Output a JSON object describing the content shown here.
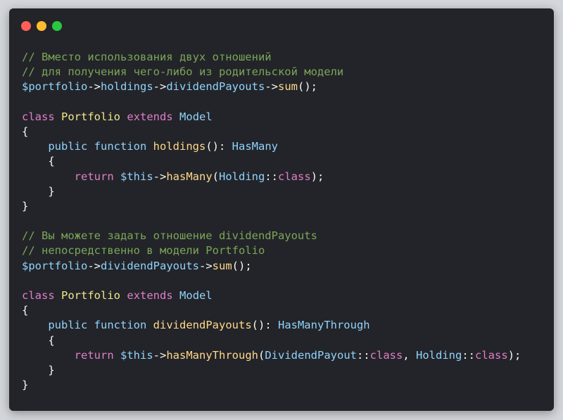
{
  "window": {
    "buttons": [
      {
        "name": "close",
        "color": "#ff5f57"
      },
      {
        "name": "minimize",
        "color": "#febc2e"
      },
      {
        "name": "maximize",
        "color": "#28c840"
      }
    ]
  },
  "colors": {
    "com": "#7ba659",
    "var": "#8fd3fc",
    "op": "#f8f8f2",
    "fn": "#ffd98a",
    "kw": "#e07ec8",
    "cls": "#f1e88a",
    "typ": "#8fd3fc",
    "p": "#f8f8f2"
  },
  "code_lines": [
    [
      [
        "com",
        "// Вместо использования двух отношений"
      ]
    ],
    [
      [
        "com",
        "// для получения чего-либо из родительской модели"
      ]
    ],
    [
      [
        "var",
        "$portfolio"
      ],
      [
        "op",
        "->"
      ],
      [
        "var",
        "holdings"
      ],
      [
        "op",
        "->"
      ],
      [
        "var",
        "dividendPayouts"
      ],
      [
        "op",
        "->"
      ],
      [
        "fn",
        "sum"
      ],
      [
        "p",
        "();"
      ]
    ],
    [],
    [
      [
        "kw",
        "class"
      ],
      [
        "p",
        " "
      ],
      [
        "cls",
        "Portfolio"
      ],
      [
        "p",
        " "
      ],
      [
        "kw",
        "extends"
      ],
      [
        "p",
        " "
      ],
      [
        "typ",
        "Model"
      ]
    ],
    [
      [
        "p",
        "{"
      ]
    ],
    [
      [
        "p",
        "    "
      ],
      [
        "var",
        "public"
      ],
      [
        "p",
        " "
      ],
      [
        "var",
        "function"
      ],
      [
        "p",
        " "
      ],
      [
        "fn",
        "holdings"
      ],
      [
        "p",
        "(): "
      ],
      [
        "typ",
        "HasMany"
      ]
    ],
    [
      [
        "p",
        "    {"
      ]
    ],
    [
      [
        "p",
        "        "
      ],
      [
        "kw",
        "return"
      ],
      [
        "p",
        " "
      ],
      [
        "var",
        "$this"
      ],
      [
        "op",
        "->"
      ],
      [
        "fn",
        "hasMany"
      ],
      [
        "p",
        "("
      ],
      [
        "typ",
        "Holding"
      ],
      [
        "op",
        "::"
      ],
      [
        "kw",
        "class"
      ],
      [
        "p",
        ");"
      ]
    ],
    [
      [
        "p",
        "    }"
      ]
    ],
    [
      [
        "p",
        "}"
      ]
    ],
    [],
    [
      [
        "com",
        "// Вы можете задать отношение dividendPayouts"
      ]
    ],
    [
      [
        "com",
        "// непосредственно в модели Portfolio"
      ]
    ],
    [
      [
        "var",
        "$portfolio"
      ],
      [
        "op",
        "->"
      ],
      [
        "var",
        "dividendPayouts"
      ],
      [
        "op",
        "->"
      ],
      [
        "fn",
        "sum"
      ],
      [
        "p",
        "();"
      ]
    ],
    [],
    [
      [
        "kw",
        "class"
      ],
      [
        "p",
        " "
      ],
      [
        "cls",
        "Portfolio"
      ],
      [
        "p",
        " "
      ],
      [
        "kw",
        "extends"
      ],
      [
        "p",
        " "
      ],
      [
        "typ",
        "Model"
      ]
    ],
    [
      [
        "p",
        "{"
      ]
    ],
    [
      [
        "p",
        "    "
      ],
      [
        "var",
        "public"
      ],
      [
        "p",
        " "
      ],
      [
        "var",
        "function"
      ],
      [
        "p",
        " "
      ],
      [
        "fn",
        "dividendPayouts"
      ],
      [
        "p",
        "(): "
      ],
      [
        "typ",
        "HasManyThrough"
      ]
    ],
    [
      [
        "p",
        "    {"
      ]
    ],
    [
      [
        "p",
        "        "
      ],
      [
        "kw",
        "return"
      ],
      [
        "p",
        " "
      ],
      [
        "var",
        "$this"
      ],
      [
        "op",
        "->"
      ],
      [
        "fn",
        "hasManyThrough"
      ],
      [
        "p",
        "("
      ],
      [
        "typ",
        "DividendPayout"
      ],
      [
        "op",
        "::"
      ],
      [
        "kw",
        "class"
      ],
      [
        "p",
        ", "
      ],
      [
        "typ",
        "Holding"
      ],
      [
        "op",
        "::"
      ],
      [
        "kw",
        "class"
      ],
      [
        "p",
        ");"
      ]
    ],
    [
      [
        "p",
        "    }"
      ]
    ],
    [
      [
        "p",
        "}"
      ]
    ]
  ]
}
